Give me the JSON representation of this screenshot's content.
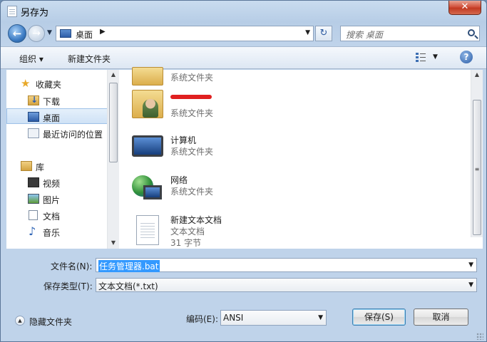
{
  "window": {
    "title": "另存为",
    "close_label": "✕"
  },
  "nav": {
    "back_icon": "arrow-left-icon",
    "forward_icon": "arrow-right-icon",
    "address": "桌面",
    "search_placeholder": "搜索 桌面"
  },
  "toolbar": {
    "organize": "组织 ▾",
    "new_folder": "新建文件夹",
    "help": "?"
  },
  "sidebar": {
    "items": [
      {
        "label": "收藏夹",
        "icon": "star-icon"
      },
      {
        "label": "下载",
        "icon": "download-folder-icon"
      },
      {
        "label": "桌面",
        "icon": "desktop-icon",
        "selected": true
      },
      {
        "label": "最近访问的位置",
        "icon": "recent-places-icon"
      },
      {
        "label": "库",
        "icon": "library-icon"
      },
      {
        "label": "视频",
        "icon": "video-icon"
      },
      {
        "label": "图片",
        "icon": "pictures-icon"
      },
      {
        "label": "文档",
        "icon": "documents-icon"
      },
      {
        "label": "音乐",
        "icon": "music-icon"
      }
    ]
  },
  "files": [
    {
      "name": "",
      "type": "系统文件夹",
      "icon": "folder-icon"
    },
    {
      "name": "",
      "type": "系统文件夹",
      "icon": "user-folder-icon",
      "name_redacted": true
    },
    {
      "name": "计算机",
      "type": "系统文件夹",
      "icon": "computer-icon"
    },
    {
      "name": "网络",
      "type": "系统文件夹",
      "icon": "network-icon"
    },
    {
      "name": "新建文本文档",
      "type": "文本文档",
      "size": "31 字节",
      "icon": "text-file-icon"
    }
  ],
  "form": {
    "filename_label": "文件名(N):",
    "filename_value": "任务管理器.bat",
    "savetype_label": "保存类型(T):",
    "savetype_value": "文本文档(*.txt)",
    "encoding_label": "编码(E):",
    "encoding_value": "ANSI",
    "save_button": "保存(S)",
    "cancel_button": "取消",
    "hide_folders": "隐藏文件夹"
  }
}
